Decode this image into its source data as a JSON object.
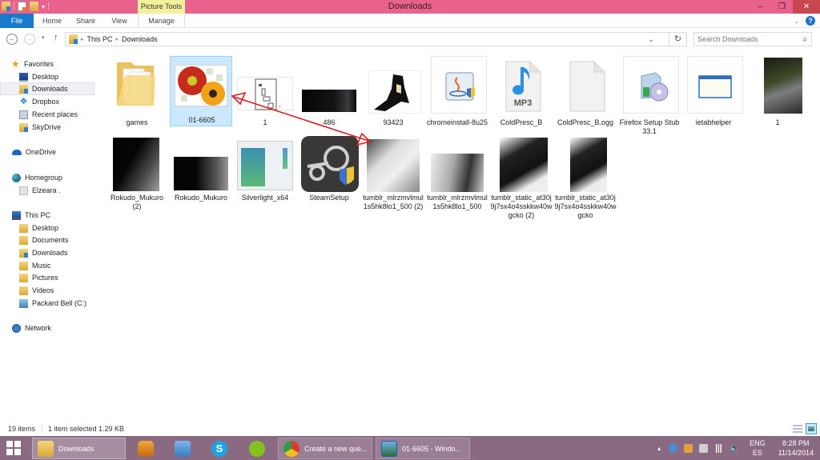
{
  "window": {
    "title": "Downloads",
    "context_tab": "Picture Tools",
    "controls": {
      "minimize": "–",
      "restore": "❐",
      "close": "✕"
    },
    "accent_color": "#e7628c"
  },
  "ribbon": {
    "tabs": [
      {
        "label": "File",
        "active": true
      },
      {
        "label": "Home"
      },
      {
        "label": "Share"
      },
      {
        "label": "View"
      },
      {
        "label": "Manage"
      }
    ],
    "help": "?",
    "collapse": "⌄"
  },
  "nav": {
    "back": "←",
    "forward": "→",
    "recent": "▾",
    "up": "↑",
    "breadcrumb": [
      "This PC",
      "Downloads"
    ],
    "separator": "▸",
    "dropdown": "⌄",
    "refresh": "↻",
    "search_placeholder": "Search Downloads",
    "search_icon": "⌕"
  },
  "sidebar": {
    "favorites": {
      "label": "Favorites",
      "items": [
        {
          "label": "Desktop",
          "icon": "desktop-icon"
        },
        {
          "label": "Downloads",
          "icon": "downloads-folder-icon",
          "selected": true
        },
        {
          "label": "Dropbox",
          "icon": "dropbox-icon"
        },
        {
          "label": "Recent places",
          "icon": "recent-places-icon"
        },
        {
          "label": "SkyDrive",
          "icon": "skydrive-folder-icon"
        }
      ]
    },
    "onedrive": {
      "label": "OneDrive"
    },
    "homegroup": {
      "label": "Homegroup",
      "items": [
        {
          "label": "Elzeara ."
        }
      ]
    },
    "thispc": {
      "label": "This PC",
      "items": [
        {
          "label": "Desktop"
        },
        {
          "label": "Documents"
        },
        {
          "label": "Downloads"
        },
        {
          "label": "Music"
        },
        {
          "label": "Pictures"
        },
        {
          "label": "Videos"
        },
        {
          "label": "Packard Bell (C:)"
        }
      ]
    },
    "network": {
      "label": "Network"
    }
  },
  "files": [
    {
      "name": "games",
      "type": "folder"
    },
    {
      "name": "01-6605",
      "type": "image",
      "selected": true
    },
    {
      "name": "1",
      "type": "image"
    },
    {
      "name": "486",
      "type": "image"
    },
    {
      "name": "93423",
      "type": "image"
    },
    {
      "name": "chromeinstall-8u25",
      "type": "java-installer"
    },
    {
      "name": "ColdPresc_B",
      "type": "mp3"
    },
    {
      "name": "ColdPresc_B.ogg",
      "type": "blank-file"
    },
    {
      "name": "Firefox Setup Stub 33.1",
      "type": "installer"
    },
    {
      "name": "ietabhelper",
      "type": "application"
    },
    {
      "name": "1",
      "type": "image"
    },
    {
      "name": "Rokudo_Mukuro (2)",
      "type": "image"
    },
    {
      "name": "Rokudo_Mukuro",
      "type": "image"
    },
    {
      "name": "Silverlight_x64",
      "type": "installer"
    },
    {
      "name": "SteamSetup",
      "type": "steam-installer"
    },
    {
      "name": "tumblr_mlrzmvlmul1s5hk8lo1_500 (2)",
      "type": "image"
    },
    {
      "name": "tumblr_mlrzmvlmul1s5hk8lo1_500",
      "type": "image"
    },
    {
      "name": "tumblr_static_at30j9j7sx4o4sskkw40wgcko (2)",
      "type": "image"
    },
    {
      "name": "tumblr_static_at30j9j7sx4o4sskkw40wgcko",
      "type": "image"
    }
  ],
  "status": {
    "item_count": "19 items",
    "selection": "1 item selected  1.29 KB"
  },
  "taskbar": {
    "color": "#8a6a83",
    "buttons": [
      {
        "label": "Downloads",
        "state": "active"
      },
      {
        "label": "",
        "icon": "ibooks-icon"
      },
      {
        "label": "",
        "icon": "control-panel-icon"
      },
      {
        "label": "",
        "icon": "skype-icon"
      },
      {
        "label": "",
        "icon": "spotify-icon"
      },
      {
        "label": "Create a new que...",
        "icon": "chrome-icon",
        "state": "open"
      },
      {
        "label": "01-6605 - Windo...",
        "icon": "photo-viewer-icon",
        "state": "open"
      }
    ],
    "tray": {
      "show_hidden": "▴",
      "language": "ENG",
      "keyboard": "ES",
      "time": "8:28 PM",
      "date": "11/14/2014"
    }
  },
  "annotation": {
    "type": "double-headed-arrow",
    "color": "#e01e1e"
  }
}
